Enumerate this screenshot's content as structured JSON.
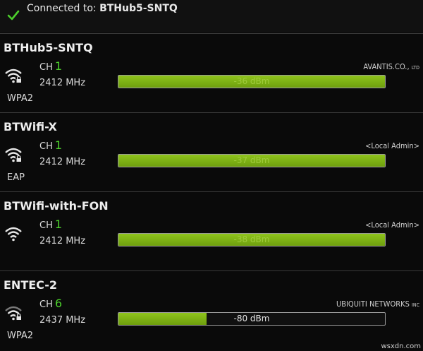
{
  "connection": {
    "prefix": "Connected to: ",
    "ssid": "BTHub5-SNTQ",
    "accent": "#4ccf2c"
  },
  "networks": [
    {
      "ssid": "BTHub5-SNTQ",
      "channel_label": "CH",
      "channel": "1",
      "frequency": "2412 MHz",
      "security": "WPA2",
      "vendor": "AVANTIS.CO.,",
      "vendor_suffix": "LTD",
      "signal": "-36 dBm",
      "signal_strength": 1.0,
      "icon": "wifi-locked-icon"
    },
    {
      "ssid": "BTWifi-X",
      "channel_label": "CH",
      "channel": "1",
      "frequency": "2412 MHz",
      "security": "EAP",
      "vendor": "<Local Admin>",
      "vendor_suffix": "",
      "signal": "-37 dBm",
      "signal_strength": 1.0,
      "icon": "wifi-locked-icon"
    },
    {
      "ssid": "BTWifi-with-FON",
      "channel_label": "CH",
      "channel": "1",
      "frequency": "2412 MHz",
      "security": "",
      "vendor": "<Local Admin>",
      "vendor_suffix": "",
      "signal": "-38 dBm",
      "signal_strength": 1.0,
      "icon": "wifi-open-icon"
    },
    {
      "ssid": "ENTEC-2",
      "channel_label": "CH",
      "channel": "6",
      "frequency": "2437 MHz",
      "security": "WPA2",
      "vendor": "UBIQUITI NETWORKS",
      "vendor_suffix": "INC",
      "signal": "-80 dBm",
      "signal_strength": 0.33,
      "icon": "wifi-locked-icon"
    }
  ],
  "watermark": "wsxdn.com"
}
